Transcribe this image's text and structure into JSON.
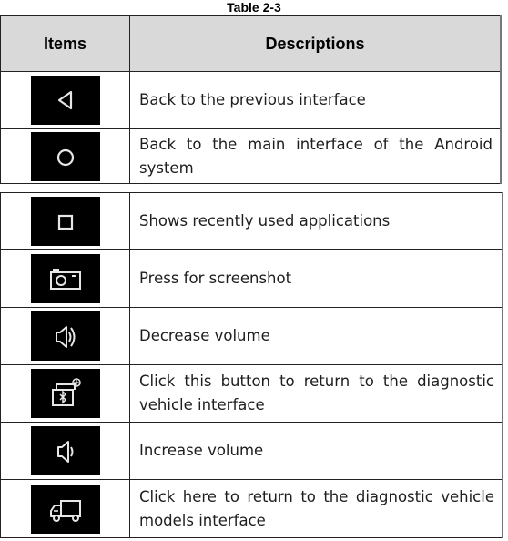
{
  "caption": "Table 2-3",
  "table": {
    "headers": [
      "Items",
      "Descriptions"
    ],
    "rows": [
      {
        "icon": "back-triangle-icon",
        "description": "Back to the previous interface"
      },
      {
        "icon": "home-circle-icon",
        "description": "Back to the main interface of the Android system"
      },
      {
        "icon": "recent-apps-square-icon",
        "description": "Shows recently used applications"
      },
      {
        "icon": "camera-screenshot-icon",
        "description": "Press for screenshot"
      },
      {
        "icon": "volume-speaker-double-wave-icon",
        "description": "Decrease volume"
      },
      {
        "icon": "bluetooth-vci-icon",
        "description": "Click this button to return to the diagnostic vehicle interface"
      },
      {
        "icon": "volume-speaker-single-wave-icon",
        "description": "Increase volume"
      },
      {
        "icon": "truck-icon",
        "description": "Click here to return to the diagnostic vehicle models interface"
      }
    ]
  },
  "colors": {
    "header_bg": "#d9d9d9",
    "icon_bg": "#000000",
    "icon_stroke": "#e6e6e6"
  }
}
